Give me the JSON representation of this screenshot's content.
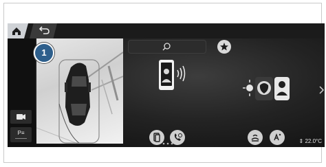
{
  "callout": {
    "number": "1"
  },
  "status": {
    "temperature": "22.0°C"
  },
  "left_column": {
    "park_label": "P≡"
  },
  "colors": {
    "callout_fill": "#2e5f8c",
    "screen_bg": "#0c0c0c",
    "topbar_bg": "#1b1b1b",
    "home_btn": "#cfd2d6"
  },
  "icons": [
    "home-icon",
    "back-icon",
    "search-icon",
    "star-icon",
    "phone-connect-icon",
    "climate-icon",
    "profile-icon",
    "camera-icon",
    "parking-icon",
    "media-icon",
    "call-icon",
    "seat-icon",
    "auto-icon",
    "chevron-right-icon",
    "page-dots-icon"
  ]
}
